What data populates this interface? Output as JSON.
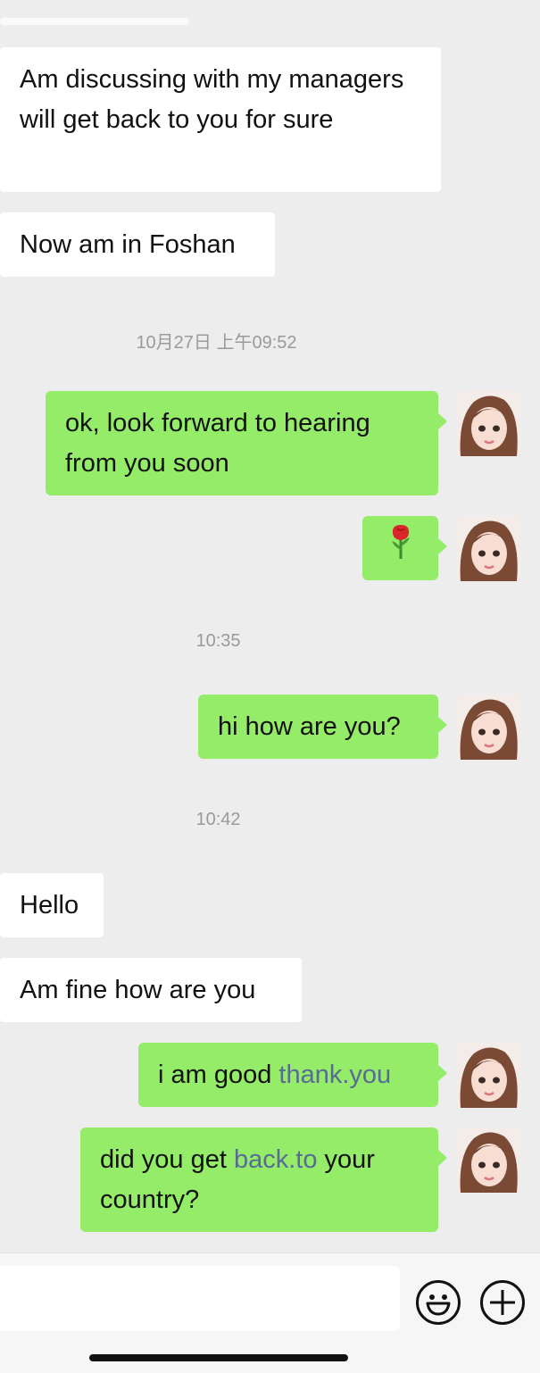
{
  "messages": [
    {
      "side": "left",
      "text": "Am discussing with my managers will get back to you for sure"
    },
    {
      "side": "left",
      "text": "Now am in Foshan"
    },
    {
      "type": "time",
      "text": "10月27日 上午09:52"
    },
    {
      "side": "right",
      "text": "ok, look forward to hearing from you soon"
    },
    {
      "side": "right",
      "icon": "rose-emoji-icon"
    },
    {
      "type": "time",
      "text": "10:35"
    },
    {
      "side": "right",
      "text": "hi how are you?"
    },
    {
      "type": "time",
      "text": "10:42"
    },
    {
      "side": "left",
      "text": "Hello"
    },
    {
      "side": "left",
      "text": "Am fine how are you"
    },
    {
      "side": "right",
      "text_before": "i am good ",
      "link": "thank.you"
    },
    {
      "side": "right",
      "text_before": "did you get ",
      "link": "back.to",
      "text_after_line1": " your",
      "text_line2": "country?"
    }
  ],
  "input_bar": {
    "emoji_icon": "emoji-smiley-icon",
    "more_icon": "plus-circle-icon"
  },
  "colors": {
    "background": "#ededed",
    "sent_bubble": "#95ec69",
    "received_bubble": "#ffffff",
    "link": "#576b95",
    "timestamp": "#9a9a9a"
  }
}
